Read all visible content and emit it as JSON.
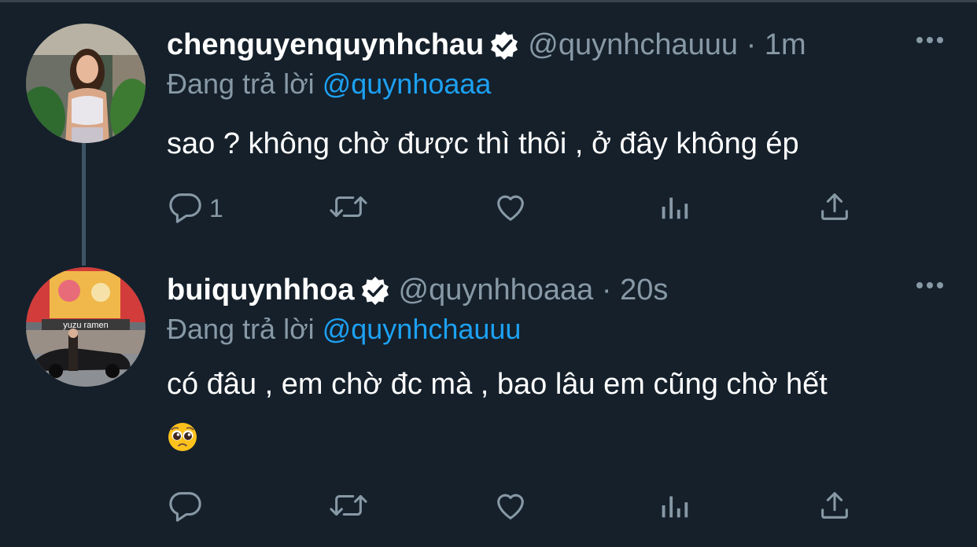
{
  "tweets": [
    {
      "display_name": "chenguyenquynhchau",
      "handle": "@quynhchauuu",
      "time": "1m",
      "replying_prefix": "Đang trả lời",
      "replying_to": "@quynhoaaa",
      "text": "sao ? không chờ được thì thôi , ở đây không ép",
      "reply_count": "1",
      "verified": true
    },
    {
      "display_name": "buiquynhhoa",
      "handle": "@quynhhoaaa",
      "time": "20s",
      "replying_prefix": "Đang trả lời",
      "replying_to": "@quynhchauuu",
      "text": "có đâu , em chờ đc mà , bao lâu em cũng chờ hết",
      "emoji": "pleading-face",
      "reply_count": "",
      "verified": true
    }
  ],
  "avatar2_signs": {
    "yuzu": "yuzu ramen"
  },
  "colors": {
    "background": "#15202b",
    "secondary_text": "#8899a6",
    "link": "#1da1f2",
    "thread_line": "#3d5466"
  }
}
